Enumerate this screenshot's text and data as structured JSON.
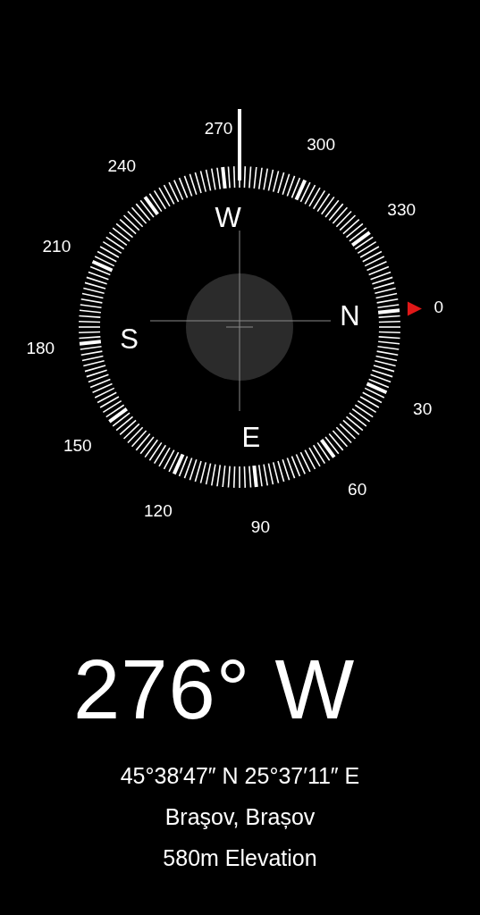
{
  "compass": {
    "degree_labels": [
      "0",
      "30",
      "60",
      "90",
      "120",
      "150",
      "180",
      "210",
      "240",
      "270",
      "300",
      "330"
    ],
    "cardinal_labels": [
      "N",
      "E",
      "S",
      "W"
    ],
    "north_marker": true
  },
  "heading": "276° W",
  "coordinates": "45°38′47″ N  25°37′11″ E",
  "location": "Braşov, Brașov",
  "elevation": "580m Elevation"
}
